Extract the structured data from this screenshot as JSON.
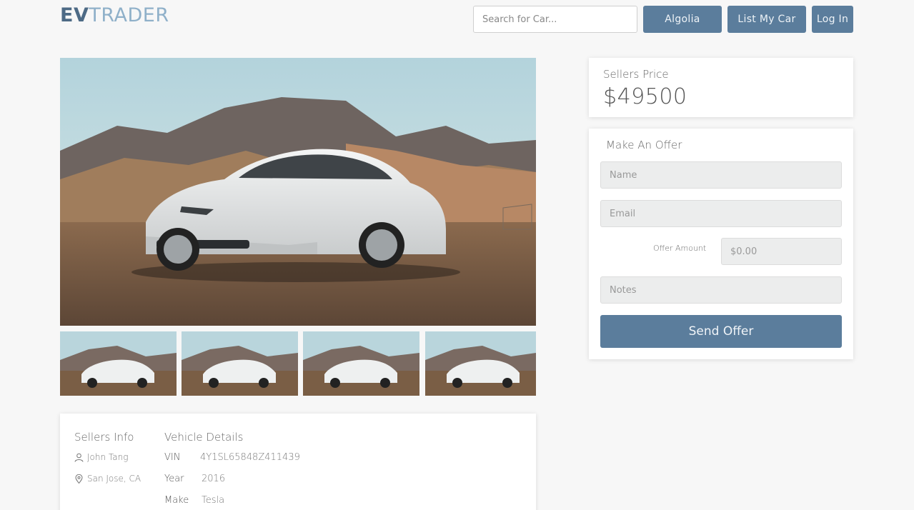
{
  "header": {
    "logo_ev": "EV",
    "logo_trader": "TRADER",
    "search_placeholder": "Search for Car...",
    "algolia_label": "Algolia",
    "list_label": "List My Car",
    "login_label": "Log In"
  },
  "gallery": {
    "main_image": "white electric sedan in desert",
    "thumbnail_count": 4
  },
  "seller": {
    "title": "Sellers Info",
    "name": "John Tang",
    "location": "San Jose, CA",
    "name_icon": "user-icon",
    "location_icon": "map-pin-icon"
  },
  "vehicle": {
    "title": "Vehicle Details",
    "rows": [
      {
        "label": "VIN",
        "value": "4Y1SL65848Z411439"
      },
      {
        "label": "Year",
        "value": "2016"
      },
      {
        "label": "Make",
        "value": "Tesla"
      }
    ]
  },
  "price": {
    "label": "Sellers Price",
    "value": "$49500"
  },
  "offer": {
    "title": "Make An Offer",
    "name_placeholder": "Name",
    "email_placeholder": "Email",
    "amount_label": "Offer Amount",
    "amount_placeholder": "$0.00",
    "notes_placeholder": "Notes",
    "send_label": "Send Offer"
  },
  "colors": {
    "accent": "#5b7d9c",
    "logo_dark": "#4d6a85",
    "logo_light": "#8fb0c9",
    "background": "#f7f7f7"
  }
}
